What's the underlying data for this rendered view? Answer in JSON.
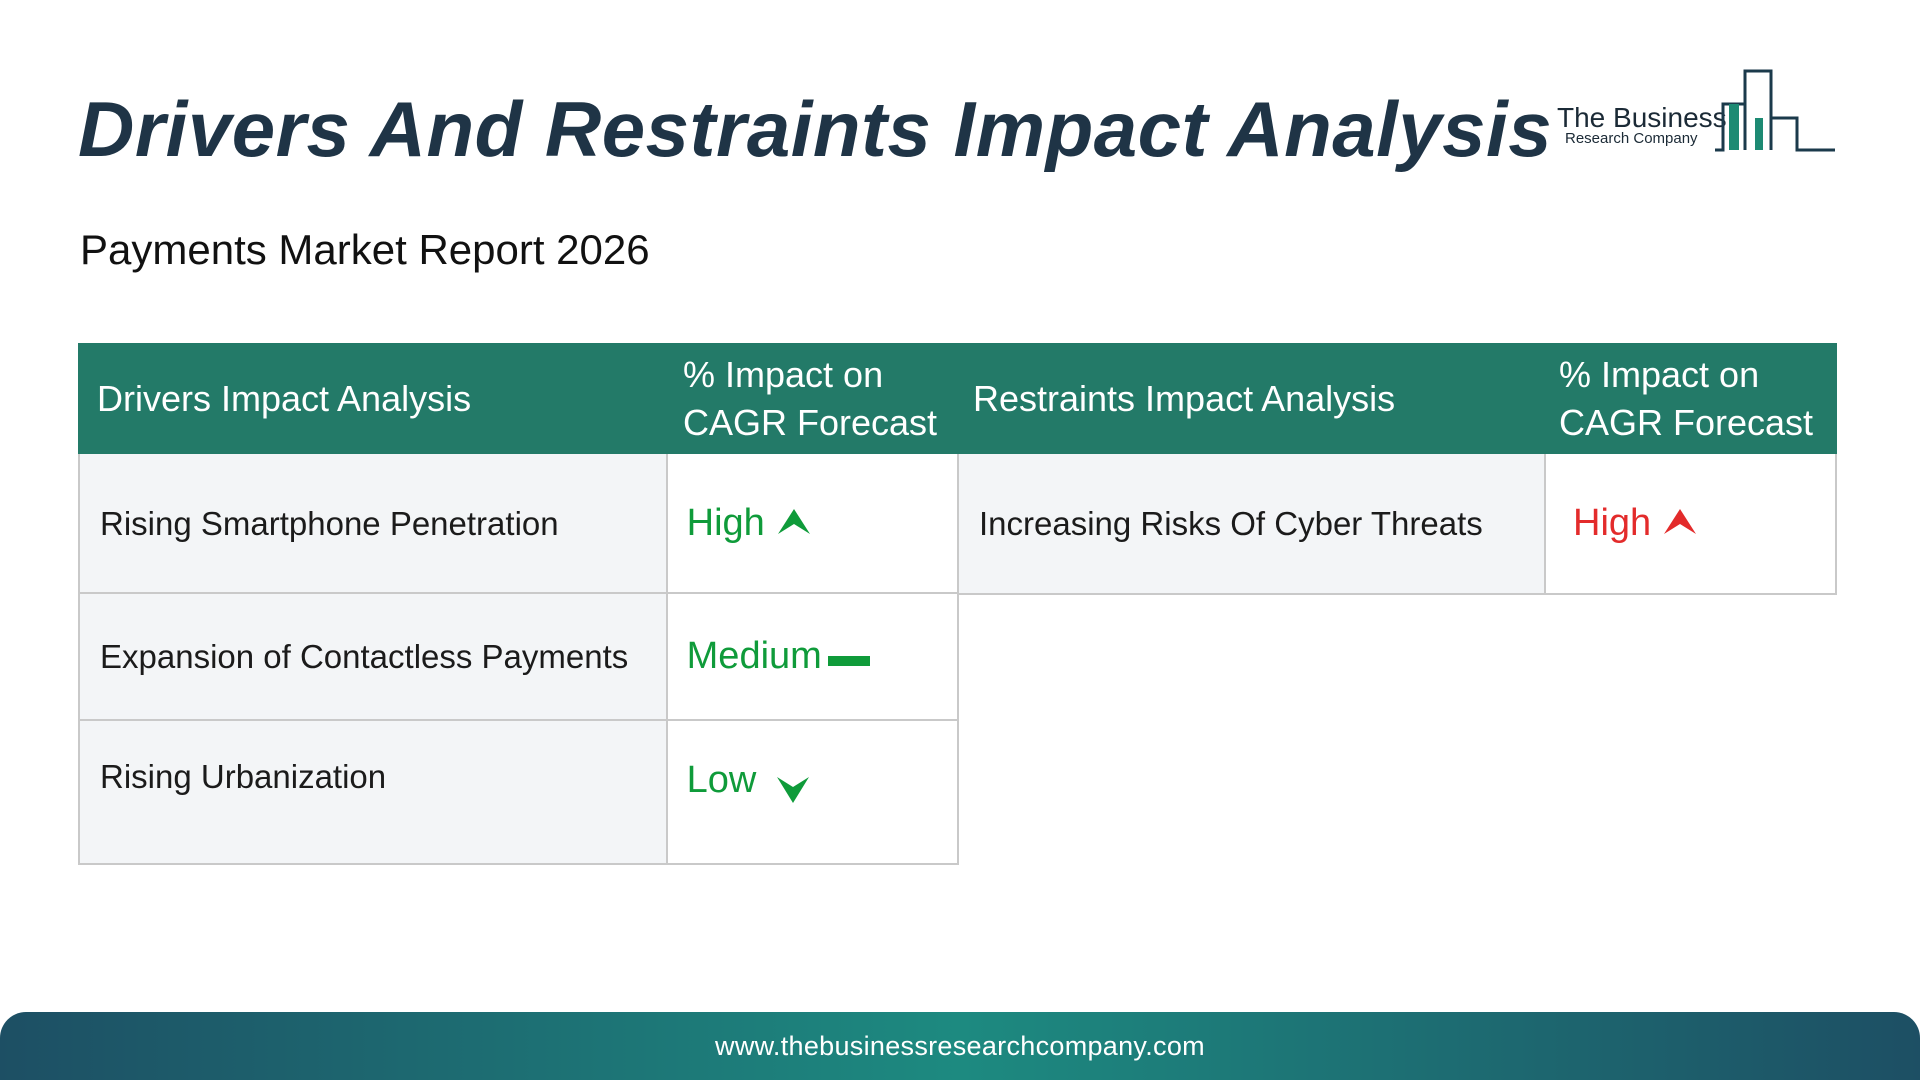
{
  "header": {
    "title": "Drivers And Restraints Impact Analysis",
    "subtitle": "Payments Market Report 2026"
  },
  "logo": {
    "line1": "The Business",
    "line2": "Research Company"
  },
  "table": {
    "headers": {
      "drivers": "Drivers Impact Analysis",
      "drivers_impact": "% Impact on CAGR Forecast",
      "restraints": "Restraints Impact Analysis",
      "restraints_impact": "% Impact on CAGR Forecast"
    },
    "drivers": [
      {
        "label": "Rising Smartphone Penetration",
        "impact": "High",
        "icon": "arrow-up-icon"
      },
      {
        "label": "Expansion of Contactless Payments",
        "impact": "Medium",
        "icon": "dash-icon"
      },
      {
        "label": "Rising Urbanization",
        "impact": "Low",
        "icon": "arrow-down-icon"
      }
    ],
    "restraints": [
      {
        "label": "Increasing Risks Of Cyber Threats",
        "impact": "High",
        "icon": "arrow-up-icon"
      }
    ]
  },
  "colors": {
    "header_bg": "#237a68",
    "driver_green": "#0f9b3a",
    "restraint_red": "#e32b2b",
    "title": "#1f3446"
  },
  "footer": {
    "url": "www.thebusinessresearchcompany.com"
  }
}
